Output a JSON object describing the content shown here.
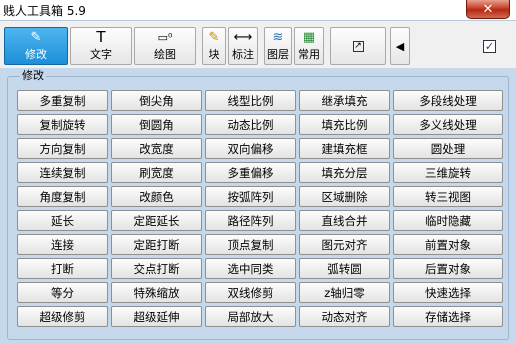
{
  "window": {
    "title": "贱人工具箱 5.9",
    "close_glyph": "✕"
  },
  "toolbar": {
    "tabs": [
      {
        "label": "修改",
        "icon": "pencil-icon",
        "glyph": "✎",
        "active": true
      },
      {
        "label": "文字",
        "icon": "text-icon",
        "glyph": "T"
      },
      {
        "label": "绘图",
        "icon": "drawing-icon",
        "glyph": "▭⁰"
      },
      {
        "label": "块",
        "icon": "block-icon",
        "glyph": "✎"
      },
      {
        "label": "标注",
        "icon": "dimension-icon",
        "glyph": "⟷"
      },
      {
        "label": "图层",
        "icon": "layers-icon",
        "glyph": "≋"
      },
      {
        "label": "常用",
        "icon": "common-icon",
        "glyph": "▦"
      },
      {
        "label": "",
        "icon": "export-icon",
        "glyph": "↗"
      },
      {
        "label": "",
        "icon": "arrow-left-icon",
        "glyph": "◀"
      }
    ],
    "checkbox_checked": true,
    "check_glyph": "✓"
  },
  "group": {
    "label": "修改",
    "buttons": [
      "多重复制",
      "倒尖角",
      "线型比例",
      "继承填充",
      "多段线处理",
      "复制旋转",
      "倒圆角",
      "动态比例",
      "填充比例",
      "多义线处理",
      "方向复制",
      "改宽度",
      "双向偏移",
      "建填充框",
      "圆处理",
      "连续复制",
      "刷宽度",
      "多重偏移",
      "填充分层",
      "三维旋转",
      "角度复制",
      "改颜色",
      "按弧阵列",
      "区域删除",
      "转三视图",
      "延长",
      "定距延长",
      "路径阵列",
      "直线合并",
      "临时隐藏",
      "连接",
      "定距打断",
      "顶点复制",
      "图元对齐",
      "前置对象",
      "打断",
      "交点打断",
      "选中同类",
      "弧转圆",
      "后置对象",
      "等分",
      "特殊缩放",
      "双线修剪",
      "z轴归零",
      "快速选择",
      "超级修剪",
      "超级延伸",
      "局部放大",
      "动态对齐",
      "存储选择"
    ]
  }
}
